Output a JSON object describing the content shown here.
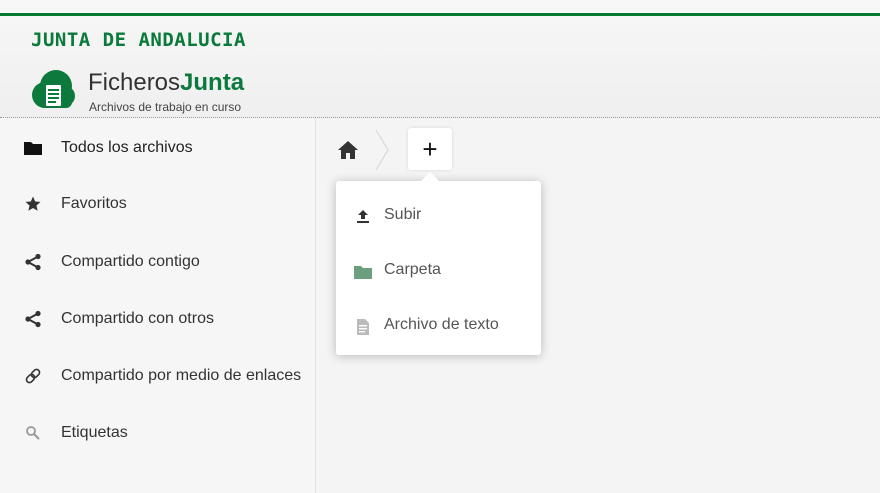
{
  "header": {
    "brand": "JUNTA DE ANDALUCIA",
    "app_name_part1": "Ficheros",
    "app_name_part2": "Junta",
    "app_subtitle": "Archivos de trabajo en curso"
  },
  "sidebar": {
    "items": [
      {
        "label": "Todos los archivos",
        "icon": "folder-icon"
      },
      {
        "label": "Favoritos",
        "icon": "star-icon"
      },
      {
        "label": "Compartido contigo",
        "icon": "share-icon"
      },
      {
        "label": "Compartido con otros",
        "icon": "share-icon"
      },
      {
        "label": "Compartido por medio de enlaces",
        "icon": "link-icon"
      },
      {
        "label": "Etiquetas",
        "icon": "search-icon"
      }
    ]
  },
  "toolbar": {
    "new_label": "+"
  },
  "new_menu": {
    "items": [
      {
        "label": "Subir",
        "icon": "upload-icon"
      },
      {
        "label": "Carpeta",
        "icon": "folder-icon"
      },
      {
        "label": "Archivo de texto",
        "icon": "text-file-icon"
      }
    ]
  },
  "colors": {
    "brand_green": "#0a7a3a",
    "folder_green": "#6c9f7e",
    "header_line": "#007a33"
  }
}
